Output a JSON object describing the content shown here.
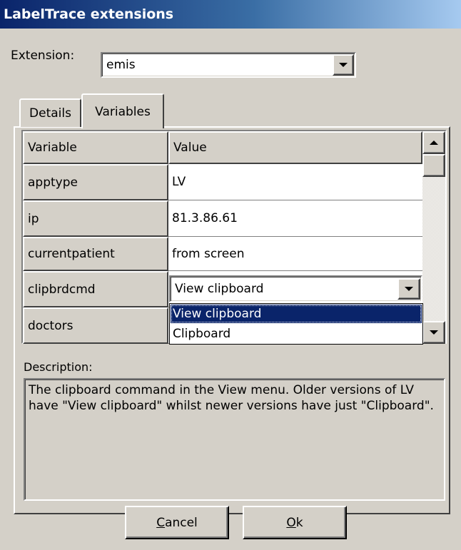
{
  "window": {
    "title": "LabelTrace extensions"
  },
  "extension": {
    "label": "Extension:",
    "value": "emis"
  },
  "tabs": [
    {
      "label": "Details",
      "active": false
    },
    {
      "label": "Variables",
      "active": true
    }
  ],
  "grid": {
    "headers": {
      "variable": "Variable",
      "value": "Value"
    },
    "rows": [
      {
        "variable": "apptype",
        "value": "LV"
      },
      {
        "variable": "ip",
        "value": "81.3.86.61"
      },
      {
        "variable": "currentpatient",
        "value": "from screen"
      },
      {
        "variable": "clipbrdcmd",
        "value": "View clipboard",
        "editor": "dropdown"
      },
      {
        "variable": "doctors",
        "value": ""
      }
    ]
  },
  "dropdown": {
    "options": [
      "View clipboard",
      "Clipboard"
    ],
    "selected": "View clipboard"
  },
  "description": {
    "label": "Description:",
    "text": "The clipboard command in the View menu. Older versions of LV have \"View clipboard\" whilst newer versions have just \"Clipboard\"."
  },
  "buttons": {
    "cancel": "Cancel",
    "ok": "Ok"
  },
  "colors": {
    "selection": "#0a246a",
    "face": "#d4d0c8"
  }
}
